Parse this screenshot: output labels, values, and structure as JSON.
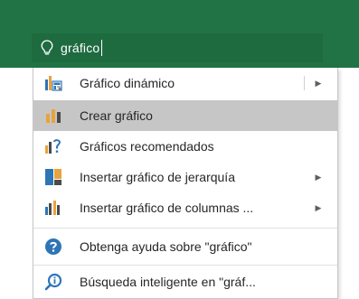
{
  "search": {
    "value": "gráfico",
    "icon": "lightbulb-icon"
  },
  "menu": {
    "items": [
      {
        "label": "Gráfico dinámico",
        "icon": "pivot-chart-icon",
        "has_submenu": true,
        "selected": false
      },
      {
        "label": "Crear gráfico",
        "icon": "create-chart-icon",
        "has_submenu": false,
        "selected": true
      },
      {
        "label": "Gráficos recomendados",
        "icon": "recommended-charts-icon",
        "has_submenu": false,
        "selected": false
      },
      {
        "label": "Insertar gráfico de jerarquía",
        "icon": "hierarchy-chart-icon",
        "has_submenu": true,
        "selected": false
      },
      {
        "label": "Insertar gráfico de columnas ...",
        "icon": "column-chart-icon",
        "has_submenu": true,
        "selected": false
      }
    ],
    "help_items": [
      {
        "label": "Obtenga ayuda sobre \"gráfico\"",
        "icon": "help-icon"
      },
      {
        "label": "Búsqueda inteligente en \"gráf...",
        "icon": "smart-lookup-icon"
      }
    ]
  },
  "colors": {
    "ribbon": "#217346",
    "search_box": "#1e6b40",
    "chart_orange": "#e8a33d",
    "chart_dark": "#4a4a4a",
    "chart_blue": "#2e75b6",
    "selected_bg": "#c6c6c6"
  }
}
